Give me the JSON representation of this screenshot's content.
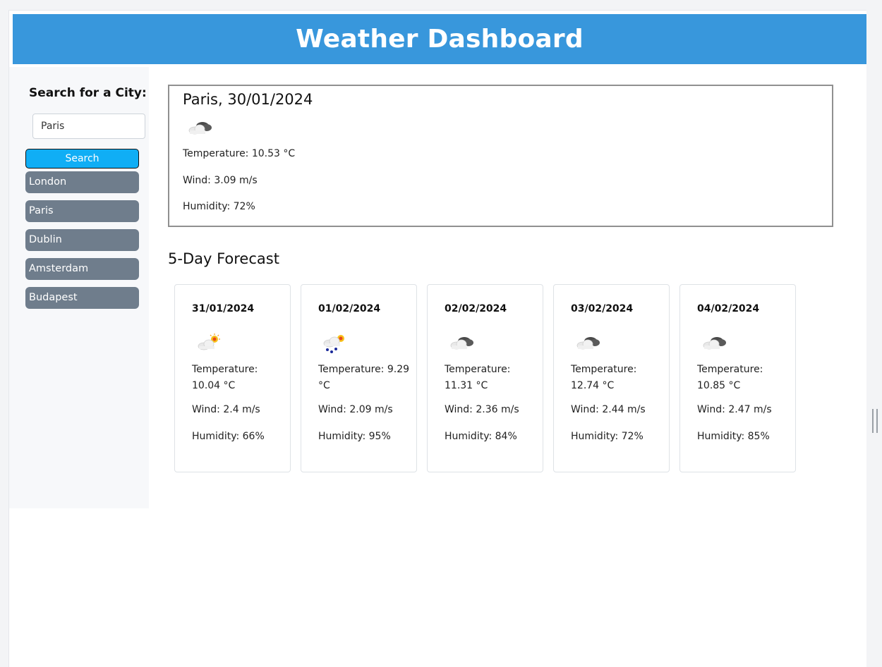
{
  "header": {
    "title": "Weather Dashboard"
  },
  "sidebar": {
    "heading": "Search for a City:",
    "search_value": "Paris",
    "search_button": "Search",
    "cities": [
      "London",
      "Paris",
      "Dublin",
      "Amsterdam",
      "Budapest"
    ]
  },
  "current": {
    "title": "Paris, 30/01/2024",
    "icon": "cloudy-icon",
    "temperature": "Temperature: 10.53 °C",
    "wind": "Wind: 3.09 m/s",
    "humidity": "Humidity: 72%"
  },
  "forecast": {
    "title": "5-Day Forecast",
    "days": [
      {
        "date": "31/01/2024",
        "icon": "partly-sunny-icon",
        "temperature": "Temperature: 10.04 °C",
        "wind": "Wind: 2.4 m/s",
        "humidity": "Humidity: 66%"
      },
      {
        "date": "01/02/2024",
        "icon": "rain-sun-icon",
        "temperature": "Temperature: 9.29 °C",
        "wind": "Wind: 2.09 m/s",
        "humidity": "Humidity: 95%"
      },
      {
        "date": "02/02/2024",
        "icon": "cloudy-icon",
        "temperature": "Temperature: 11.31 °C",
        "wind": "Wind: 2.36 m/s",
        "humidity": "Humidity: 84%"
      },
      {
        "date": "03/02/2024",
        "icon": "cloudy-icon",
        "temperature": "Temperature: 12.74 °C",
        "wind": "Wind: 2.44 m/s",
        "humidity": "Humidity: 72%"
      },
      {
        "date": "04/02/2024",
        "icon": "cloudy-icon",
        "temperature": "Temperature: 10.85 °C",
        "wind": "Wind: 2.47 m/s",
        "humidity": "Humidity: 85%"
      }
    ]
  },
  "colors": {
    "header": "#3897dc",
    "search_button": "#10aef5",
    "city_button": "#6f7d8c"
  }
}
